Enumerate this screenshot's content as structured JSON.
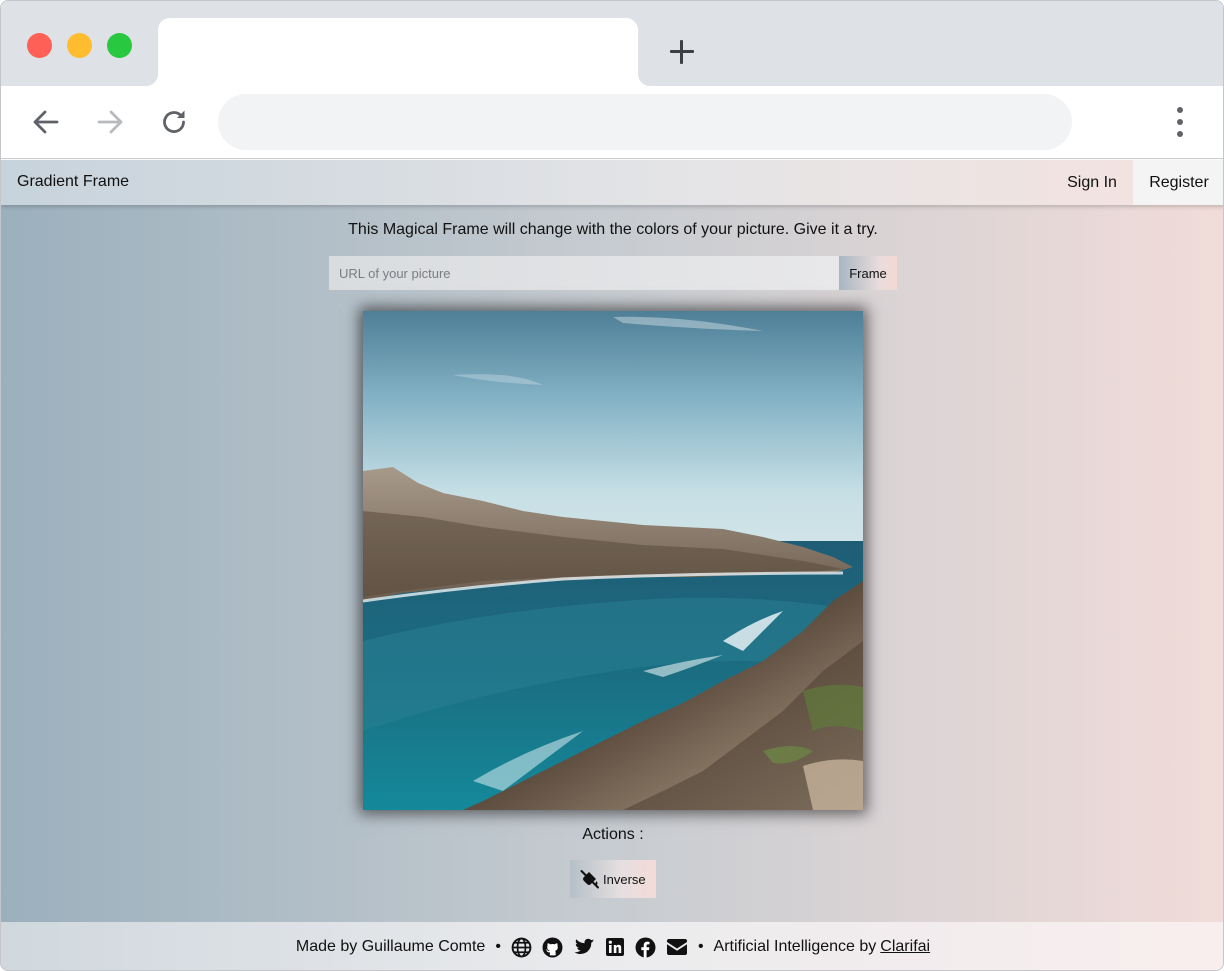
{
  "browser": {
    "tab_title": "",
    "address": "",
    "icons": {
      "back": "arrow-left-icon",
      "forward": "arrow-right-icon",
      "reload": "reload-icon",
      "menu": "kebab-menu-icon",
      "new_tab": "plus-icon"
    }
  },
  "navbar": {
    "brand": "Gradient Frame",
    "sign_in": "Sign In",
    "register": "Register"
  },
  "main": {
    "tagline": "This Magical Frame will change with the colors of your picture. Give it a try.",
    "url_input": {
      "value": "",
      "placeholder": "URL of your picture"
    },
    "frame_button": "Frame",
    "picture_alt": "Rocky coastline with turquoise sea under a pale blue sky",
    "actions_label": "Actions :",
    "inverse_button": "Inverse",
    "inverse_icon": "paint-bucket-slash-icon"
  },
  "footer": {
    "made_by": "Made by Guillaume Comte",
    "bullet": "•",
    "social_icons": [
      "globe-icon",
      "github-icon",
      "twitter-icon",
      "linkedin-icon",
      "facebook-icon",
      "envelope-icon"
    ],
    "ai_text": "Artificial Intelligence by",
    "ai_link": "Clarifai"
  },
  "colors": {
    "gradient_left": "#9bb0bd",
    "gradient_mid": "#c7ccd1",
    "gradient_right": "#f1dcd9",
    "traffic_red": "#fe5f57",
    "traffic_yellow": "#febc2e",
    "traffic_green": "#28c840"
  }
}
